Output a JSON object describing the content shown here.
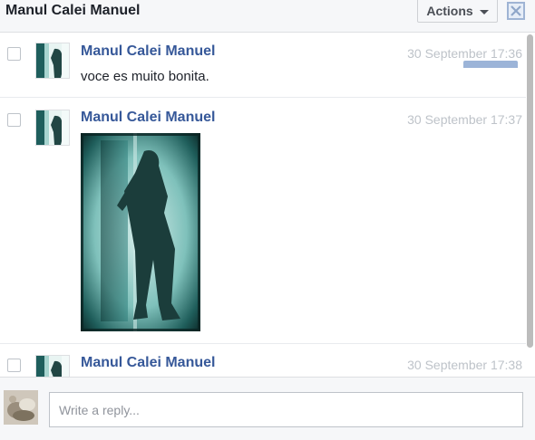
{
  "header": {
    "title": "Manul Calei Manuel",
    "actions_label": "Actions"
  },
  "messages": [
    {
      "sender": "Manul Calei Manuel",
      "timestamp": "30 September 17:36",
      "text": "voce es muito bonita."
    },
    {
      "sender": "Manul Calei Manuel",
      "timestamp": "30 September 17:37",
      "attachment": "photo"
    },
    {
      "sender": "Manul Calei Manuel",
      "timestamp": "30 September 17:38"
    }
  ],
  "reply": {
    "placeholder": "Write a reply..."
  },
  "colors": {
    "sender_link": "#365899",
    "timestamp": "#bec3c9",
    "header_bg": "#f6f7f9",
    "photo_tint": "#2a7a78"
  },
  "icons": {
    "actions_caret": "chevron-down-icon",
    "close": "close-icon"
  }
}
